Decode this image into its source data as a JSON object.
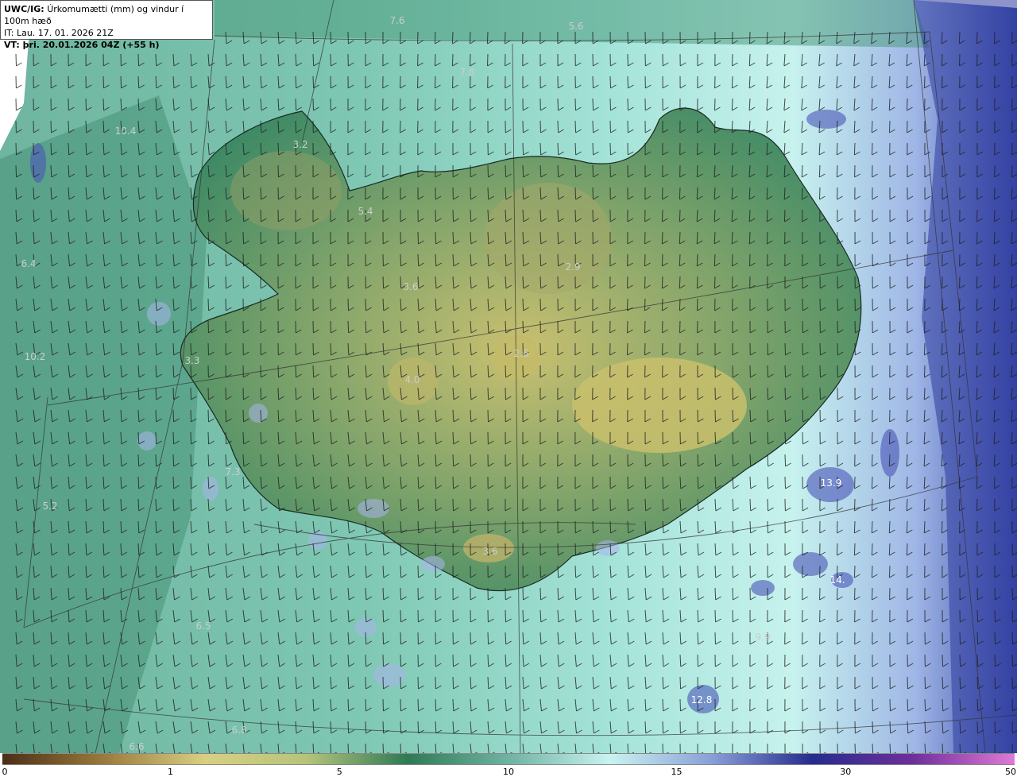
{
  "header": {
    "title_prefix": "UWC/IG:",
    "title": "Úrkomumætti (mm) og vindur í 100m hæð",
    "it_line": "IT: Lau. 17. 01. 2026 21Z",
    "vt_line": "VT: þri. 20.01.2026 04Z (+55 h)"
  },
  "map_labels": [
    {
      "text": "7.6",
      "pos": [
        500,
        26
      ]
    },
    {
      "text": "5.6",
      "pos": [
        725,
        33
      ]
    },
    {
      "text": "7.8",
      "pos": [
        588,
        91
      ]
    },
    {
      "text": "10.4",
      "pos": [
        158,
        165
      ]
    },
    {
      "text": "3.2",
      "pos": [
        378,
        182
      ]
    },
    {
      "text": "5.4",
      "pos": [
        460,
        266
      ]
    },
    {
      "text": "6.4",
      "pos": [
        36,
        332
      ]
    },
    {
      "text": "3.6",
      "pos": [
        517,
        361
      ]
    },
    {
      "text": "2.9",
      "pos": [
        721,
        336
      ]
    },
    {
      "text": "10.2",
      "pos": [
        44,
        449
      ]
    },
    {
      "text": "3.3",
      "pos": [
        242,
        454
      ]
    },
    {
      "text": "2.6",
      "pos": [
        656,
        445
      ]
    },
    {
      "text": "4.0",
      "pos": [
        519,
        478
      ]
    },
    {
      "text": "7.3",
      "pos": [
        293,
        594
      ]
    },
    {
      "text": "13.9",
      "pos": [
        1046,
        608
      ]
    },
    {
      "text": "5.2",
      "pos": [
        63,
        637
      ]
    },
    {
      "text": "3.6",
      "pos": [
        617,
        694
      ]
    },
    {
      "text": "14.",
      "pos": [
        1054,
        730
      ]
    },
    {
      "text": "6.5",
      "pos": [
        256,
        788
      ]
    },
    {
      "text": "9.9",
      "pos": [
        960,
        802
      ]
    },
    {
      "text": "12.8",
      "pos": [
        883,
        881
      ]
    },
    {
      "text": "6.8",
      "pos": [
        301,
        919
      ]
    },
    {
      "text": "6.6",
      "pos": [
        172,
        940
      ]
    }
  ],
  "colorbar": {
    "ticks": [
      {
        "label": "0",
        "frac": 0.0
      },
      {
        "label": "1",
        "frac": 0.166
      },
      {
        "label": "5",
        "frac": 0.333
      },
      {
        "label": "10",
        "frac": 0.5
      },
      {
        "label": "15",
        "frac": 0.666
      },
      {
        "label": "30",
        "frac": 0.833
      },
      {
        "label": "50",
        "frac": 1.0
      }
    ],
    "colors": [
      "#4a2e16",
      "#9b7a3c",
      "#d8cf82",
      "#b6c47a",
      "#2f7a55",
      "#6fb3a1",
      "#c9f3ef",
      "#8aa0d8",
      "#262c8e",
      "#6e2f9a",
      "#e07ad6"
    ]
  }
}
